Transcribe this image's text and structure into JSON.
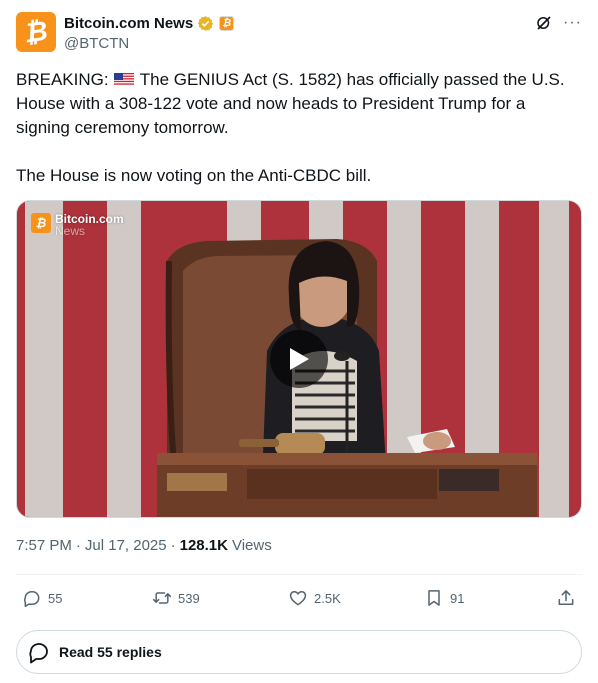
{
  "author": {
    "display_name": "Bitcoin.com News",
    "handle": "@BTCTN",
    "avatar_icon": "bitcoin-logo",
    "avatar_color": "#f7931a",
    "verified_color": "#e8b524",
    "affiliate_icon": "bitcoin-logo"
  },
  "header_actions": {
    "grok_icon": "grok-icon",
    "more_label": "···"
  },
  "tweet": {
    "paragraph1_prefix": "BREAKING: ",
    "flag_icon": "us-flag-emoji",
    "paragraph1_rest": " The GENIUS Act (S. 1582) has officially passed the U.S. House with a 308-122 vote and now heads to President Trump for a signing ceremony tomorrow.",
    "paragraph2": "The House is now voting on the Anti-CBDC bill."
  },
  "media": {
    "watermark_title": "Bitcoin.com",
    "watermark_sub": "News",
    "play_icon": "play-icon"
  },
  "meta": {
    "time": "7:57 PM",
    "date": "Jul 17, 2025",
    "views_count": "128.1K",
    "views_label": "Views"
  },
  "actions": {
    "replies": "55",
    "reposts": "539",
    "likes": "2.5K",
    "bookmarks": "91"
  },
  "read_replies_label": "Read 55 replies"
}
